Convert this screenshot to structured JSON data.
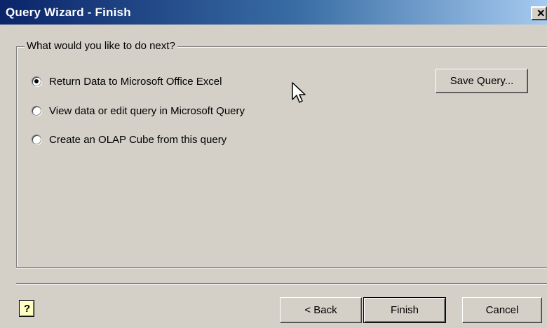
{
  "window": {
    "title": "Query Wizard - Finish",
    "close_glyph": "✕"
  },
  "group": {
    "legend": "What would you like to do next?"
  },
  "options": [
    {
      "label": "Return Data to Microsoft Office Excel",
      "selected": true
    },
    {
      "label": "View data or edit query in Microsoft Query",
      "selected": false
    },
    {
      "label": "Create an OLAP Cube from this query",
      "selected": false
    }
  ],
  "buttons": {
    "save_query": "Save Query...",
    "back": "< Back",
    "finish": "Finish",
    "cancel": "Cancel",
    "help": "?"
  },
  "icons": {
    "close": "close-icon",
    "help": "help-icon",
    "cursor": "mouse-cursor-icon"
  },
  "colors": {
    "title_start": "#0a246a",
    "title_end": "#a6caf0",
    "dialog_bg": "#d4d0c8"
  }
}
